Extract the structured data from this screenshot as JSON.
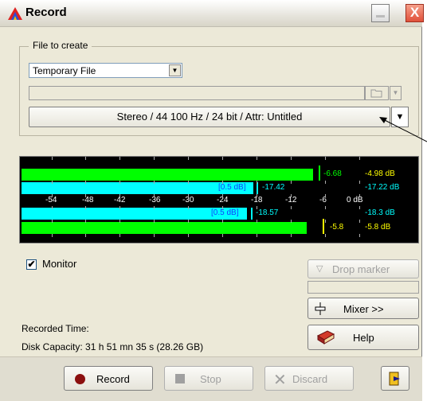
{
  "window": {
    "title": "Record",
    "minimize_label": "",
    "close_label": "X"
  },
  "file_group": {
    "legend": "File to create",
    "file_type_value": "Temporary File",
    "format_label": "Stereo / 44 100 Hz / 24 bit / Attr: Untitled"
  },
  "meter": {
    "colors": {
      "left": "#00ff00",
      "right_ref": "#00ffff",
      "background": "#000000"
    },
    "scale": [
      "-54",
      "-48",
      "-42",
      "-36",
      "-30",
      "-24",
      "-18",
      "-12",
      "-6",
      "0 dB"
    ],
    "top_green": {
      "peak": "-6.68",
      "readout": "-4.98 dB"
    },
    "top_cyan": {
      "tag": "[0.5 dB]",
      "peak": "-17.42",
      "readout": "-17.22 dB"
    },
    "bottom_cyan": {
      "tag": "[0.5 dB]",
      "peak": "-18.57",
      "readout": "-18.3 dB"
    },
    "bottom_green": {
      "peak": "-5.8",
      "readout": "-5.8 dB"
    }
  },
  "monitor": {
    "label": "Monitor",
    "checked": true,
    "check_glyph": "✔"
  },
  "side_buttons": {
    "drop_marker": "Drop marker",
    "mixer": "Mixer >>",
    "help": "Help"
  },
  "info": {
    "recorded_time": "Recorded Time:",
    "disk_capacity": "Disk Capacity: 31 h 51 mn 35 s (28.26 GB)"
  },
  "actions": {
    "record": "Record",
    "stop": "Stop",
    "discard": "Discard"
  }
}
